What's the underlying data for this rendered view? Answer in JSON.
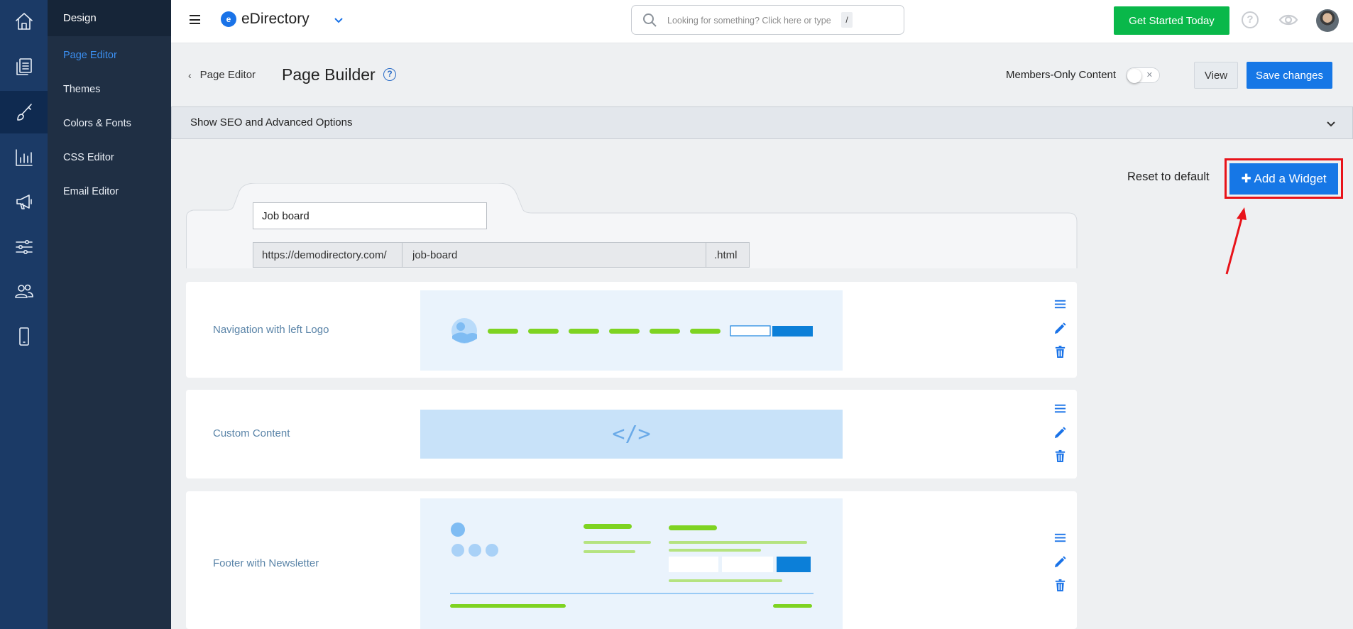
{
  "rail": {
    "items": [
      {
        "icon": "home-icon"
      },
      {
        "icon": "pages-icon"
      },
      {
        "icon": "brush-icon",
        "active": true
      },
      {
        "icon": "chart-icon"
      },
      {
        "icon": "megaphone-icon"
      },
      {
        "icon": "sliders-icon"
      },
      {
        "icon": "users-icon"
      },
      {
        "icon": "mobile-icon"
      }
    ]
  },
  "subnav": {
    "header": "Design",
    "items": [
      {
        "label": "Page Editor",
        "active": true
      },
      {
        "label": "Themes"
      },
      {
        "label": "Colors & Fonts"
      },
      {
        "label": "CSS Editor"
      },
      {
        "label": "Email Editor"
      }
    ]
  },
  "topbar": {
    "brand_logo": "e",
    "brand_name": "eDirectory",
    "search_placeholder": "Looking for something? Click here or type",
    "search_shortcut": "/",
    "cta_label": "Get Started Today",
    "help_glyph": "?"
  },
  "header": {
    "back_label": "Page Editor",
    "title": "Page Builder",
    "help_glyph": "?",
    "members_label": "Members-Only Content",
    "toggle_on": false,
    "view_label": "View",
    "save_label": "Save changes"
  },
  "seo": {
    "label": "Show SEO and Advanced Options"
  },
  "actions": {
    "reset_label": "Reset to default",
    "add_widget_label": "✚ Add a Widget"
  },
  "page": {
    "name": "Job board",
    "url_prefix": "https://demodirectory.com/",
    "url_slug": "job-board",
    "url_suffix": ".html"
  },
  "widgets": [
    {
      "label": "Navigation with left Logo"
    },
    {
      "label": "Custom Content",
      "preview_glyph": "</>"
    },
    {
      "label": "Footer with Newsletter"
    }
  ],
  "colors": {
    "primary": "#1677e6",
    "cta_green": "#09b84a",
    "highlight_red": "#e8131a",
    "rail_bg": "#1b3a66",
    "subnav_bg": "#1f2f44",
    "preview_green": "#7ed321",
    "preview_blue": "#0c7fd8"
  }
}
